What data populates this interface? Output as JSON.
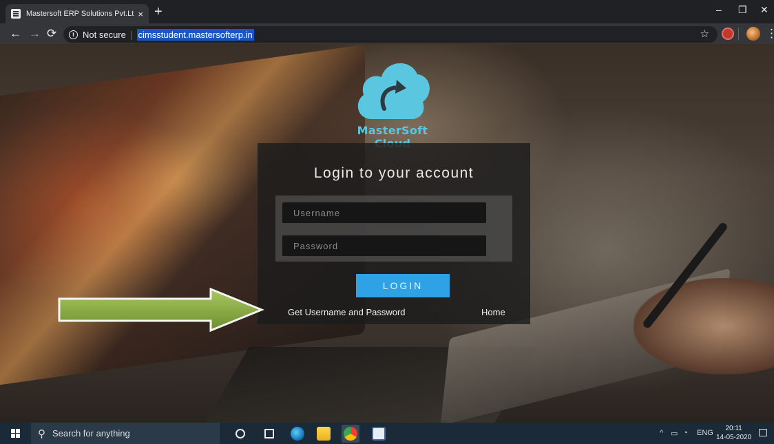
{
  "browser": {
    "tab_title": "Mastersoft ERP Solutions Pvt.Ltd",
    "tab_close": "×",
    "new_tab": "+",
    "security_label": "Not secure",
    "url": "cimsstudent.mastersofterp.in",
    "window_controls": {
      "minimize": "–",
      "restore": "❐",
      "close": "✕"
    }
  },
  "page": {
    "brand": "MasterSoft Cloud",
    "login_title": "Login to your account",
    "username_placeholder": "Username",
    "password_placeholder": "Password",
    "login_button": "LOGIN",
    "get_credentials_link": "Get Username and Password",
    "home_link": "Home",
    "accent_color": "#2fa2e6",
    "logo_color": "#5bc6e0",
    "arrow_color": "#8fb048"
  },
  "taskbar": {
    "search_placeholder": "Search for anything",
    "language": "ENG",
    "time": "20:11",
    "date": "14-05-2020"
  }
}
